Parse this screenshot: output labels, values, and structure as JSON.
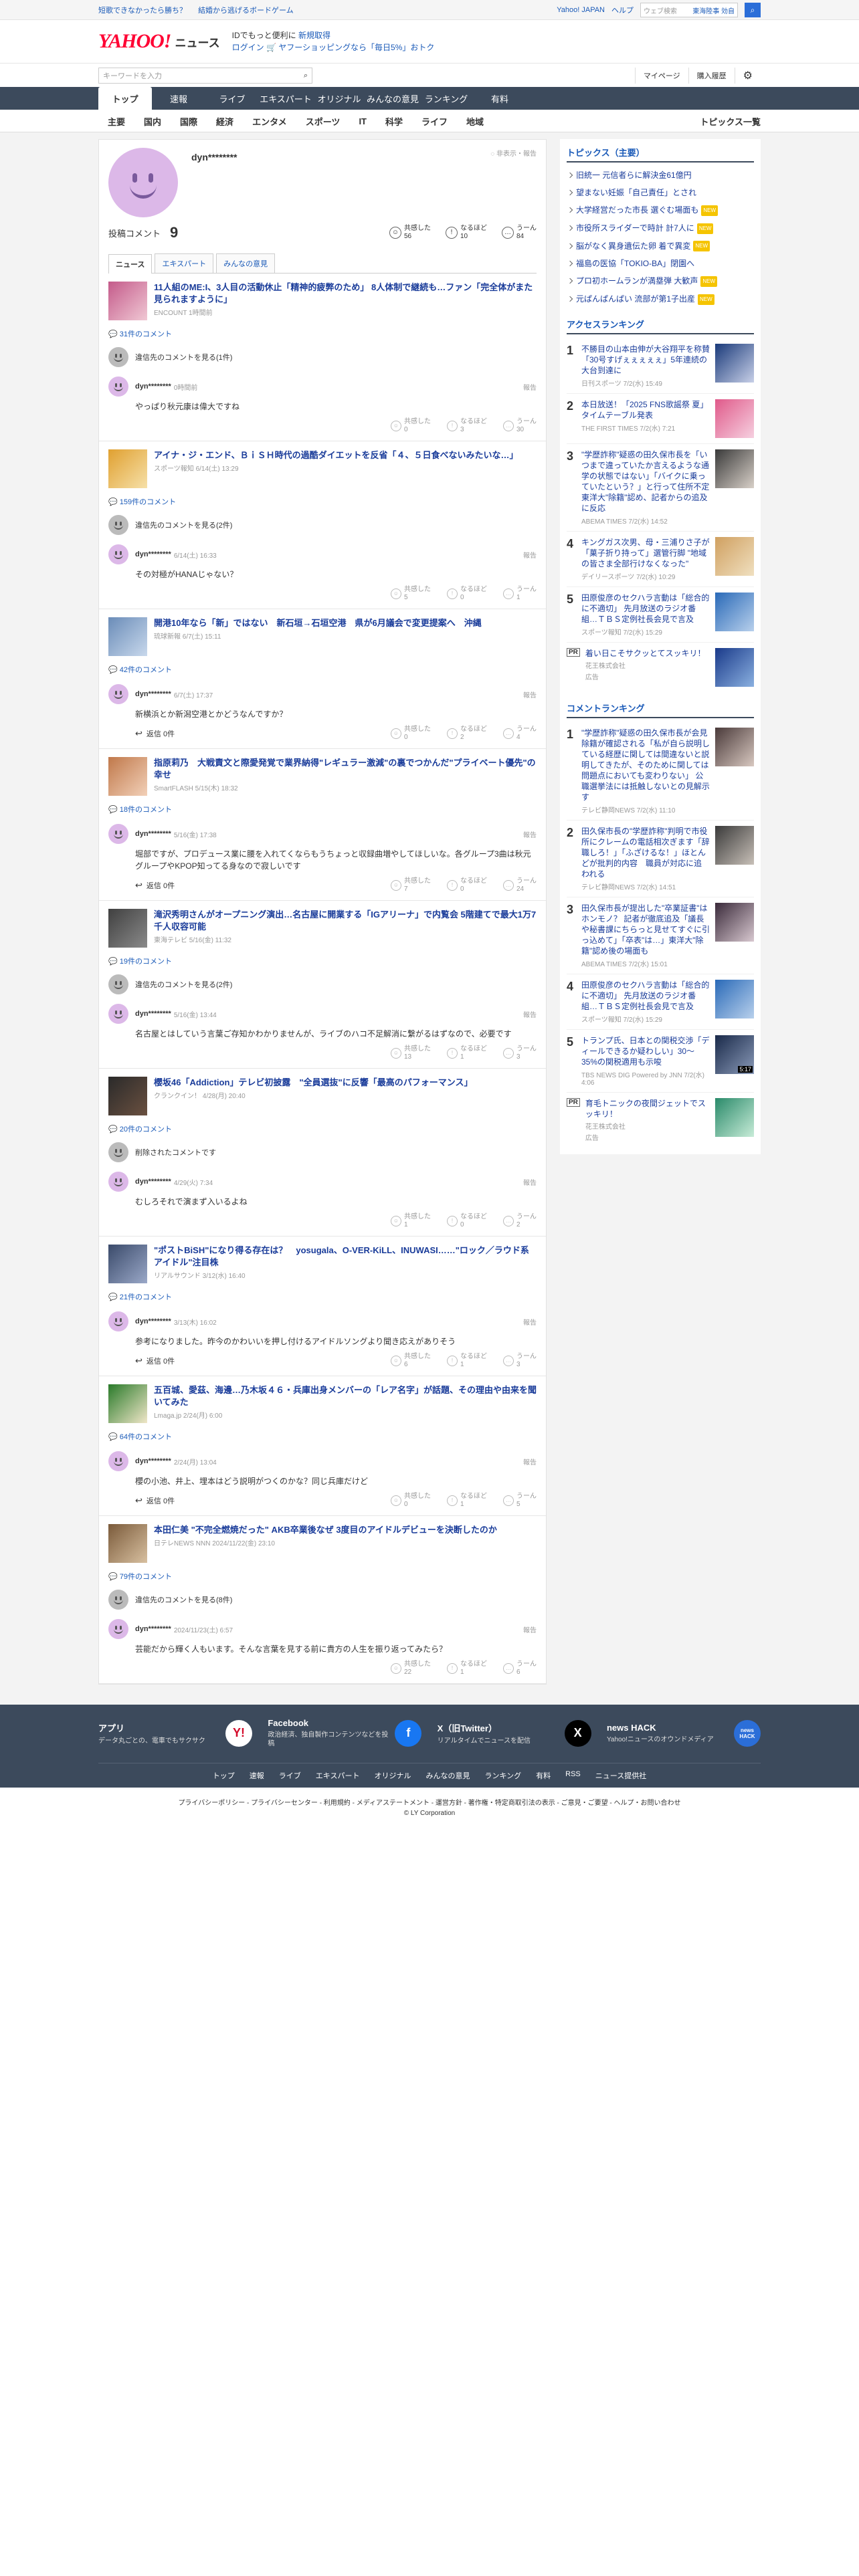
{
  "topbar": {
    "left_links": [
      "短歌できなかったら勝ち？",
      "結婚から逃げるボードゲーム"
    ],
    "right_links": [
      "Yahoo! JAPAN",
      "ヘルプ"
    ],
    "search_placeholder": "ウェブ検索",
    "search_tag": "東海陸事 効自"
  },
  "header": {
    "logo": "YAHOO!",
    "logo_sub": "JAPAN",
    "section": "ニュース",
    "msg1a": "IDでもっと便利に",
    "msg1b": "新規取得",
    "msg2a": "ログイン",
    "msg2b": "ヤフーショッピングなら「毎日5%」おトク"
  },
  "toolrow": {
    "keyword_placeholder": "キーワードを入力",
    "mypage": "マイページ",
    "history": "購入履歴"
  },
  "nav": [
    "トップ",
    "速報",
    "ライブ",
    "エキスパート",
    "オリジナル",
    "みんなの意見",
    "ランキング",
    "有料"
  ],
  "subnav": [
    "主要",
    "国内",
    "国際",
    "経済",
    "エンタメ",
    "スポーツ",
    "IT",
    "科学",
    "ライフ",
    "地域"
  ],
  "subnav_right": "トピックス一覧",
  "profile": {
    "name": "dyn********",
    "report": "非表示・報告",
    "post_label": "投稿コメント",
    "post_count": "9",
    "reactions": [
      {
        "icon": "☺",
        "label": "共感した",
        "count": "56"
      },
      {
        "icon": "!",
        "label": "なるほど",
        "count": "10"
      },
      {
        "icon": "…",
        "label": "うーん",
        "count": "84"
      }
    ],
    "tabs": [
      "ニュース",
      "エキスパート",
      "みんなの意見"
    ]
  },
  "items": [
    {
      "title": "11人組のME:I、3人目の活動休止「精神的疲弊のため」 8人体制で継続も…ファン「完全体がまた見られますように」",
      "source": "ENCOUNT 1時間前",
      "comment_link": "31件のコメント",
      "reply_more": "違信先のコメントを見る(1件)",
      "reply_gray": true,
      "user": "dyn********",
      "time": "0時間前",
      "text": "やっぱり秋元康は偉大ですね",
      "counts": [
        "0",
        "3",
        "30"
      ],
      "reply": "",
      "thumb": [
        "#c45a8a",
        "#f0c8d4"
      ]
    },
    {
      "title": "アイナ・ジ・エンド、ＢｉＳＨ時代の過酷ダイエットを反省「４、５日食べないみたいな…」",
      "source": "スポーツ報知 6/14(土) 13:29",
      "comment_link": "159件のコメント",
      "reply_more": "違信先のコメントを見る(2件)",
      "reply_gray": true,
      "user": "dyn********",
      "time": "6/14(土) 16:33",
      "text": "その対極がHANAじゃない？",
      "counts": [
        "5",
        "0",
        "1"
      ],
      "reply": "",
      "thumb": [
        "#e0a030",
        "#f6e0a8"
      ]
    },
    {
      "title": "開港10年なら「新」ではない　新石垣→石垣空港　県が6月議会で変更提案へ　沖縄",
      "source": "琉球新報 6/7(土) 15:11",
      "comment_link": "42件のコメント",
      "reply_more": "",
      "reply_gray": false,
      "user": "dyn********",
      "time": "6/7(土) 17:37",
      "text": "新横浜とか新潟空港とかどうなんですか？",
      "counts": [
        "0",
        "2",
        "4"
      ],
      "reply": "返信 0件",
      "thumb": [
        "#6a8cb8",
        "#c8d8ec"
      ]
    },
    {
      "title": "指原莉乃　大戦責文と際愛発覚で業界納得\"レギュラー激減\"の裏でつかんだ\"プライベート優先\"の幸せ",
      "source": "SmartFLASH 5/15(木) 18:32",
      "comment_link": "18件のコメント",
      "reply_more": "",
      "reply_gray": false,
      "user": "dyn********",
      "time": "5/16(金) 17:38",
      "text": "堀部ですが、プロデュース業に腰を入れてくならもうちょっと収録曲増やしてほしいな。各グループ3曲は秋元グループやKPOP知ってる身なので寂しいです",
      "counts": [
        "7",
        "0",
        "24"
      ],
      "reply": "返信 0件",
      "thumb": [
        "#c0784a",
        "#f2d0b8"
      ]
    },
    {
      "title": "滝沢秀明さんがオープニング演出…名古屋に開業する「IGアリーナ」で内覧会 5階建てで最大1万7千人収容可能",
      "source": "東海テレビ 5/16(金) 11:32",
      "comment_link": "19件のコメント",
      "reply_more": "違信先のコメントを見る(2件)",
      "reply_gray": true,
      "user": "dyn********",
      "time": "5/16(金) 13:44",
      "text": "名古屋とはしていう言葉ご存知かわかりませんが、ライブのハコ不足解消に繋がるはずなので、必要です",
      "counts": [
        "13",
        "1",
        "3"
      ],
      "reply": "",
      "thumb": [
        "#404040",
        "#8a8a8a"
      ]
    },
    {
      "title": "櫻坂46「Addiction」テレビ初披露　\"全員選抜\"に反響「最高のパフォーマンス」",
      "source": "クランクイン！ 4/28(月) 20:40",
      "comment_link": "20件のコメント",
      "reply_more": "削除されたコメントです",
      "reply_gray": true,
      "user": "dyn********",
      "time": "4/29(火) 7:34",
      "text": "むしろそれで演まず入いるよね",
      "counts": [
        "1",
        "0",
        "2"
      ],
      "reply": "",
      "thumb": [
        "#2a2a2a",
        "#6a5040"
      ]
    },
    {
      "title": "\"ポストBiSH\"になり得る存在は？　yosugala、O-VER-KiLL、INUWASI……\"ロック／ラウド系アイドル\"注目株",
      "source": "リアルサウンド 3/12(水) 16:40",
      "comment_link": "21件のコメント",
      "reply_more": "",
      "reply_gray": false,
      "user": "dyn********",
      "time": "3/13(木) 16:02",
      "text": "参考になりました。昨今のかわいいを押し付けるアイドルソングより聞き応えがありそう",
      "counts": [
        "6",
        "1",
        "3"
      ],
      "reply": "返信 0件",
      "thumb": [
        "#3a4a6a",
        "#9aa8c8"
      ]
    },
    {
      "title": "五百城、愛茲、海邊…乃木坂４６・兵庫出身メンバーの「レア名字」が話題、その理由や由来を聞いてみた",
      "source": "Lmaga.jp 2/24(月) 6:00",
      "comment_link": "64件のコメント",
      "reply_more": "",
      "reply_gray": false,
      "user": "dyn********",
      "time": "2/24(月) 13:04",
      "text": "櫻の小池、井上、埋本はどう説明がつくのかな？同じ兵庫だけど",
      "counts": [
        "0",
        "1",
        "5"
      ],
      "reply": "返信 0件",
      "thumb": [
        "#2a7a2a",
        "#f0e6c8"
      ]
    },
    {
      "title": "本田仁美 \"不完全燃焼だった\" AKB卒業後なぜ 3度目のアイドルデビューを決断したのか",
      "source": "日テレNEWS NNN 2024/11/22(金) 23:10",
      "comment_link": "79件のコメント",
      "reply_more": "違信先のコメントを見る(8件)",
      "reply_gray": true,
      "user": "dyn********",
      "time": "2024/11/23(土) 6:57",
      "text": "芸能だから輝く人もいます。そんな言葉を見する前に貴方の人生を振り返ってみたら？",
      "counts": [
        "22",
        "1",
        "6"
      ],
      "reply": "",
      "thumb": [
        "#7a5a3a",
        "#d8c0a0"
      ]
    }
  ],
  "cmt_report": "報告",
  "cmt_react_labels": [
    "共感した",
    "なるほど",
    "うーん"
  ],
  "sidebar": {
    "topics_title": "トピックス（主要）",
    "topics": [
      {
        "t": "旧統一 元信者らに解決金61億円",
        "n": false
      },
      {
        "t": "望まない妊娠「自己責任」とされ",
        "n": false
      },
      {
        "t": "大学経営だった市長 選ぐむ場面も",
        "n": true
      },
      {
        "t": "市役所スライダーで時計 計7人に",
        "n": true
      },
      {
        "t": "脳がなく異身遺伝た卵 着で異変",
        "n": true
      },
      {
        "t": "福島の医協「TOKIO-BA」閉園へ",
        "n": false
      },
      {
        "t": "プロ初ホームランが満塁弾 大歓声",
        "n": true
      },
      {
        "t": "元ぱんぱんぱい 流部が第1子出産",
        "n": true
      }
    ],
    "access_title": "アクセスランキング",
    "access": [
      {
        "t": "不勝目の山本由伸が大谷翔平を称賛「30号すげぇぇぇぇぇ」5年連続の大台到達に",
        "s": "日刊スポーツ 7/2(水) 15:49",
        "c": [
          "#1a3a7a",
          "#c8d0e8"
        ]
      },
      {
        "t": "本日放送！「2025 FNS歌謡祭 夏」タイムテーブル発表",
        "s": "THE FIRST TIMES 7/2(水) 7:21",
        "c": [
          "#e05a8a",
          "#f6d0e0"
        ]
      },
      {
        "t": "\"学歴詐称\"疑惑の田久保市長を「いつまで違っていたか言えるような通学の状態ではない」「バイクに乗っていたという？」と行って住所不定 東洋大\"除籍\"認め、記者からの追及に反応",
        "s": "ABEMA TIMES 7/2(水) 14:52",
        "c": [
          "#3a3a3a",
          "#d8d0c8"
        ]
      },
      {
        "t": "キングガス次男、母・三浦りさ子が「菓子折り持って」選管行脚 \"地域の皆さま全部行けなくなった\"",
        "s": "デイリースポーツ 7/2(水) 10:29",
        "c": [
          "#d0a060",
          "#f0e0c0"
        ]
      },
      {
        "t": "田原俊彦のセクハラ言動は「総合的に不適切」 先月放送のラジオ番組…ＴＢＳ定例社長会見で言及",
        "s": "スポーツ報知 7/2(水) 15:29",
        "c": [
          "#2a6ab8",
          "#b8d0ec"
        ]
      }
    ],
    "pr1_tag": "PR",
    "pr1_t": "着い日こそサクッとてスッキリ！",
    "pr1_s": "花王株式会社",
    "pr1_ad": "広告",
    "comment_title": "コメントランキング",
    "comments": [
      {
        "t": "\"学歴詐称\"疑惑の田久保市長が会見　除籍が確認される「私が自ら説明している経歴に関しては間違ないと説明してきたが、そのために関しては問題点においても変わりない」 公職選挙法には抵触しないとの見解示す",
        "s": "テレビ静岡NEWS 7/2(水) 11:10",
        "c": [
          "#4a3a3a",
          "#d8c8c0"
        ]
      },
      {
        "t": "田久保市長の\"学歴詐称\"判明で市役所にクレームの電話相次ぎます「辞職しろ！」「ふざけるな！」ほとんどが批判的内容　職員が対応に追われる",
        "s": "テレビ静岡NEWS 7/2(水) 14:51",
        "c": [
          "#3a3a3a",
          "#c8c0b8"
        ]
      },
      {
        "t": "田久保市長が提出した\"卒業証書\"はホンモノ？ 記者が徹底追及「議長や秘書課にちらっと見せてすぐに引っ込めて」「卒表\"は…」東洋大\"除籍\"認め後の場面も",
        "s": "ABEMA TIMES 7/2(水) 15:01",
        "c": [
          "#3a2a3a",
          "#d8c8d0"
        ]
      },
      {
        "t": "田原俊彦のセクハラ言動は「総合的に不適切」 先月放送のラジオ番組…ＴＢＳ定例社長会見で言及",
        "s": "スポーツ報知 7/2(水) 15:29",
        "c": [
          "#2a6ab8",
          "#b8d0ec"
        ]
      },
      {
        "t": "トランプ氏、日本との関税交渉「ディールできるか疑わしい」30～35%の関税適用も示唆",
        "s": "TBS NEWS DIG Powered by JNN 7/2(水) 4:06",
        "c": [
          "#1a2a4a",
          "#8a9ab8"
        ],
        "dur": "5:17"
      }
    ],
    "pr2_tag": "PR",
    "pr2_t": "育毛トニックの夜間ジェットでスッキリ！",
    "pr2_s": "花王株式会社",
    "pr2_ad": "広告"
  },
  "footer": {
    "boxes": [
      {
        "t1": "アプリ",
        "t2": "データ丸ごとの、電車でもサクサク",
        "icon": "Y!",
        "bg": "#ffffff",
        "fg": "#d30a2a"
      },
      {
        "t1": "Facebook",
        "t2": "政治経済、独自製作コンテンツなどを投稿",
        "icon": "f",
        "bg": "#1877f2",
        "fg": "#ffffff"
      },
      {
        "t1": "X（旧Twitter）",
        "t2": "リアルタイムでニュースを配信",
        "icon": "X",
        "bg": "#000000",
        "fg": "#ffffff"
      },
      {
        "t1": "news HACK",
        "t2": "Yahoo!ニュースのオウンドメディア",
        "icon": "news HACK",
        "bg": "#2b6ed8",
        "fg": "#ffffff"
      }
    ],
    "links": [
      "トップ",
      "速報",
      "ライブ",
      "エキスパート",
      "オリジナル",
      "みんなの意見",
      "ランキング",
      "有料",
      "RSS",
      "ニュース提供社"
    ],
    "legal": "プライバシーポリシー - プライバシーセンター - 利用規約 - メディアステートメント - 運営方針 - 著作権・特定商取引法の表示 - ご意見・ご要望 - ヘルプ・お問い合わせ",
    "copy": "© LY Corporation"
  }
}
